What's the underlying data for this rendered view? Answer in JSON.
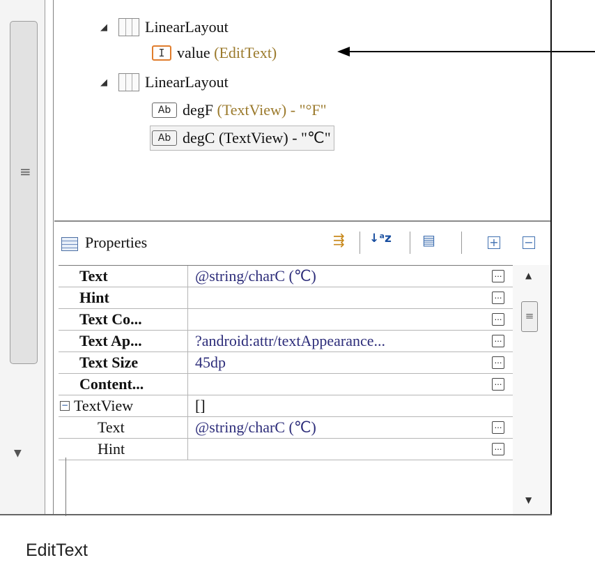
{
  "outline": {
    "items": [
      {
        "name": "LinearLayout",
        "type": "",
        "text": ""
      },
      {
        "name": "value",
        "type": "(EditText)",
        "text": ""
      },
      {
        "name": "LinearLayout",
        "type": "",
        "text": ""
      },
      {
        "name": "degF",
        "type": "(TextView)",
        "text": "- \"°F\""
      },
      {
        "name": "degC",
        "type": "(TextView)",
        "text": "- \"℃\""
      }
    ],
    "icon_labels": {
      "edit": "I",
      "ab": "Ab"
    }
  },
  "properties": {
    "title": "Properties",
    "rows": [
      {
        "name": "Text",
        "value": "@string/charC (℃)"
      },
      {
        "name": "Hint",
        "value": ""
      },
      {
        "name": "Text Co...",
        "value": ""
      },
      {
        "name": "Text Ap...",
        "value": "?android:attr/textAppearance..."
      },
      {
        "name": "Text Size",
        "value": "45dp"
      },
      {
        "name": "Content...",
        "value": ""
      },
      {
        "name": "TextView",
        "value": "[]"
      },
      {
        "name": "Text",
        "value": "@string/charC (℃)"
      },
      {
        "name": "Hint",
        "value": ""
      }
    ],
    "ellipsis": "…"
  },
  "caption": "EditText",
  "colors": {
    "type_gold": "#9b7a2c",
    "edit_icon_border": "#e07d2d",
    "value_text": "#2d2d7a"
  }
}
